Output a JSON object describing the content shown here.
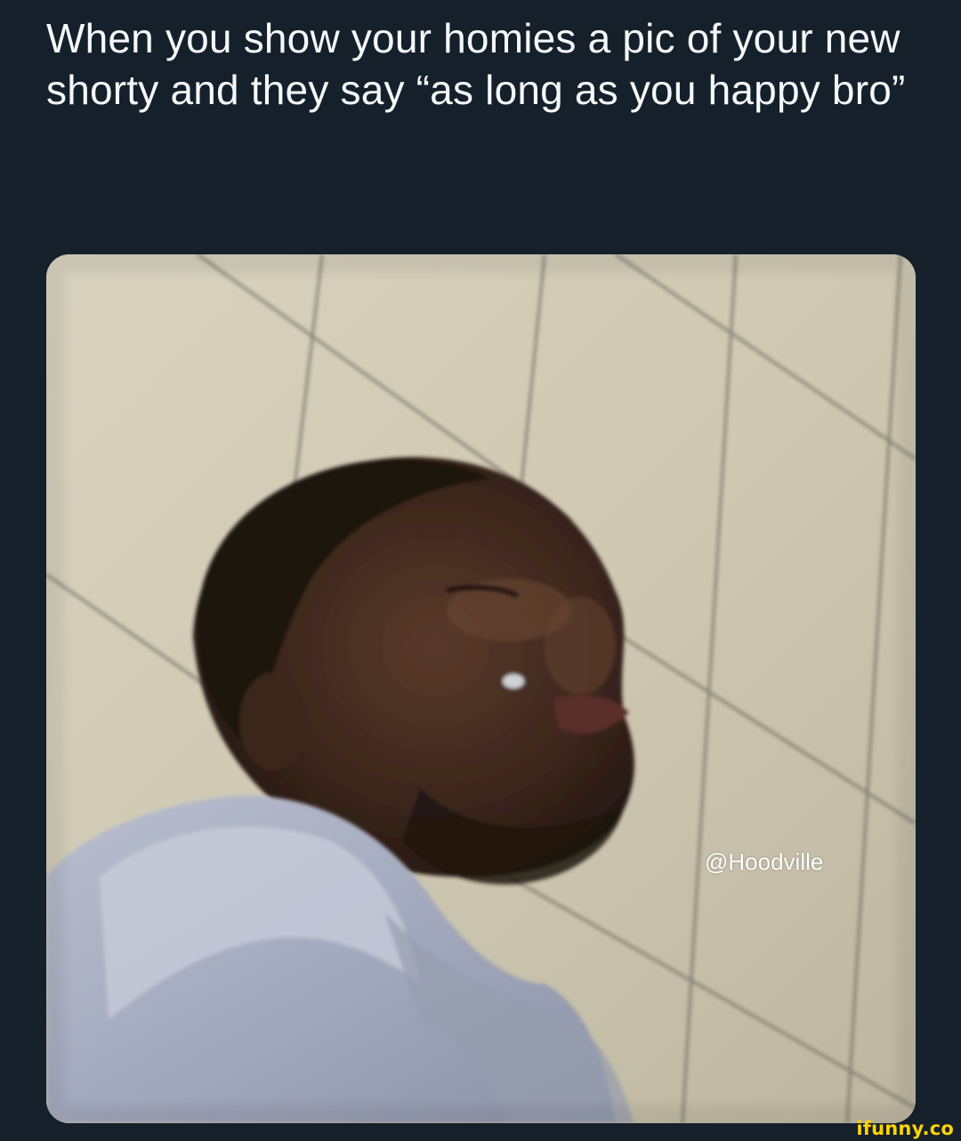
{
  "tweet": {
    "text": "When you show your homies a pic of your new shorty and they say “as long as you happy bro”"
  },
  "media": {
    "watermark": "@Hoodville"
  },
  "footer": {
    "logo": "ifunny.co"
  },
  "colors": {
    "background": "#15202b",
    "text": "#f5f8fa",
    "logo": "#ffd400"
  }
}
